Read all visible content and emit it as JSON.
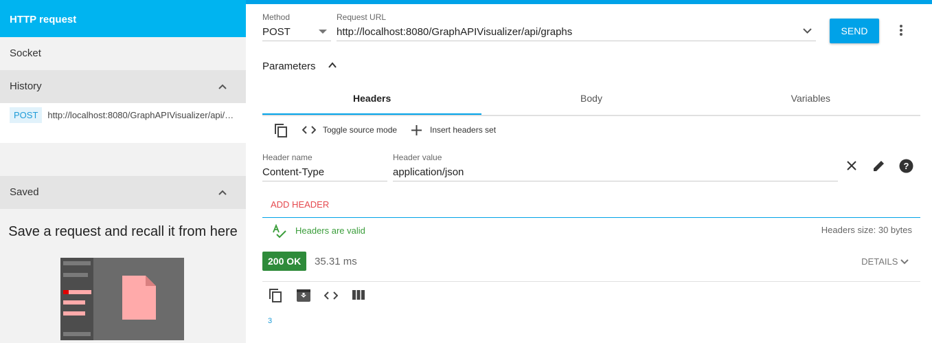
{
  "sidebar": {
    "items": [
      {
        "label": "HTTP request"
      },
      {
        "label": "Socket"
      },
      {
        "label": "History"
      }
    ],
    "history": [
      {
        "method": "POST",
        "url": "http://localhost:8080/GraphAPIVisualizer/api/graphs"
      }
    ],
    "saved": {
      "label": "Saved",
      "message": "Save a request and recall it from here"
    }
  },
  "request": {
    "method_label": "Method",
    "method_value": "POST",
    "url_label": "Request URL",
    "url_value": "http://localhost:8080/GraphAPIVisualizer/api/graphs",
    "send_label": "SEND"
  },
  "parameters": {
    "label": "Parameters",
    "tabs": [
      {
        "label": "Headers"
      },
      {
        "label": "Body"
      },
      {
        "label": "Variables"
      }
    ],
    "toolbar": {
      "toggle_label": "Toggle source mode",
      "insert_label": "Insert headers set"
    },
    "header": {
      "name_label": "Header name",
      "name_value": "Content-Type",
      "value_label": "Header value",
      "value_value": "application/json"
    },
    "add_header_label": "ADD HEADER",
    "valid_text": "Headers are valid",
    "size_text": "Headers size: 30 bytes"
  },
  "response": {
    "status": "200 OK",
    "time": "35.31 ms",
    "details_label": "DETAILS",
    "body": "3"
  },
  "colors": {
    "accent": "#00a2e8",
    "success": "#2e8b3a",
    "danger": "#e5484d"
  }
}
